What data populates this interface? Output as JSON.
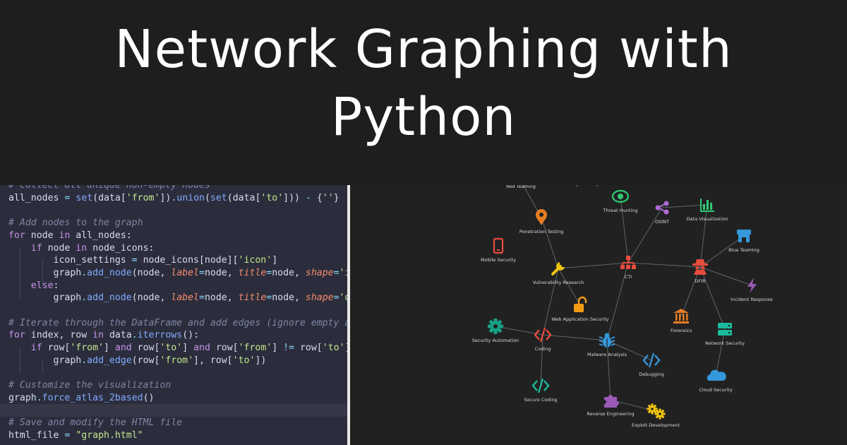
{
  "title": {
    "line1": "Network Graphing with",
    "line2": "Python"
  },
  "code": {
    "lines": [
      "# collect all unique non-empty nodes",
      "all_nodes = set(data['from']).union(set(data['to'])) - {''}",
      "",
      "# Add nodes to the graph",
      "for node in all_nodes:",
      "    if node in node_icons:",
      "        icon_settings = node_icons[node]['icon']",
      "        graph.add_node(node, label=node, title=node, shape='i",
      "    else:",
      "        graph.add_node(node, label=node, title=node, shape='d",
      "",
      "# Iterate through the DataFrame and add edges (ignore empty a",
      "for index, row in data.iterrows():",
      "    if row['from'] and row['to'] and row['from'] != row['to']",
      "        graph.add_edge(row['from'], row['to'])",
      "",
      "# Customize the visualization",
      "graph.force_atlas_2based()",
      "",
      "# Save and modify the HTML file",
      "html_file = \"graph.html\""
    ]
  },
  "graph": {
    "nodes": [
      {
        "id": "red-teaming",
        "label": "Red Teaming",
        "icon": "none-icon",
        "color": "#999999"
      },
      {
        "id": "active-directory-security",
        "label": "Active Directory Security",
        "icon": "none-icon",
        "color": "#999999"
      },
      {
        "id": "threat-hunting",
        "label": "Threat Hunting",
        "icon": "eye-icon",
        "color": "#2ecc71"
      },
      {
        "id": "osint",
        "label": "OSINT",
        "icon": "share-icon",
        "color": "#b06ad6"
      },
      {
        "id": "data-visualization",
        "label": "Data Visualization",
        "icon": "chart-icon",
        "color": "#2ecc71"
      },
      {
        "id": "penetration-testing",
        "label": "Penetration Testing",
        "icon": "map-pin-icon",
        "color": "#e67e22"
      },
      {
        "id": "blue-teaming",
        "label": "Blue Teaming",
        "icon": "store-icon",
        "color": "#3498db"
      },
      {
        "id": "mobile-security",
        "label": "Mobile Security",
        "icon": "phone-icon",
        "color": "#e74c3c"
      },
      {
        "id": "cti",
        "label": "CTI",
        "icon": "sitemap-icon",
        "color": "#e74c3c"
      },
      {
        "id": "dfir",
        "label": "DFIR",
        "icon": "detective-icon",
        "color": "#e74c3c"
      },
      {
        "id": "vulnerability-research",
        "label": "Vulnerability Research",
        "icon": "wrench-icon",
        "color": "#f1c40f"
      },
      {
        "id": "incident-response",
        "label": "Incident Response",
        "icon": "bolt-icon",
        "color": "#9b59b6"
      },
      {
        "id": "web-application-security",
        "label": "Web Application Security",
        "icon": "unlock-icon",
        "color": "#f39c12"
      },
      {
        "id": "forensics",
        "label": "Forensics",
        "icon": "bank-icon",
        "color": "#e67e22"
      },
      {
        "id": "security-automation",
        "label": "Security Automation",
        "icon": "gear-icon",
        "color": "#16a085"
      },
      {
        "id": "coding",
        "label": "Coding",
        "icon": "code-icon",
        "color": "#e74c3c"
      },
      {
        "id": "malware-analysis",
        "label": "Malware Analysis",
        "icon": "bug-icon",
        "color": "#3498db"
      },
      {
        "id": "network-security",
        "label": "Network Security",
        "icon": "server-icon",
        "color": "#1abc9c"
      },
      {
        "id": "debugging",
        "label": "Debugging",
        "icon": "code-icon",
        "color": "#3498db"
      },
      {
        "id": "cloud-security",
        "label": "Cloud Security",
        "icon": "cloud-icon",
        "color": "#3498db"
      },
      {
        "id": "secure-coding",
        "label": "Secure Coding",
        "icon": "code-icon",
        "color": "#1abc9c"
      },
      {
        "id": "reverse-engineering",
        "label": "Reverse Engineering",
        "icon": "puzzle-icon",
        "color": "#9b59b6"
      },
      {
        "id": "exploit-development",
        "label": "Exploit Development",
        "icon": "gears-icon",
        "color": "#f1c40f"
      }
    ],
    "edges": [
      [
        "red-teaming",
        "penetration-testing"
      ],
      [
        "penetration-testing",
        "vulnerability-research"
      ],
      [
        "vulnerability-research",
        "cti"
      ],
      [
        "vulnerability-research",
        "web-application-security"
      ],
      [
        "vulnerability-research",
        "coding"
      ],
      [
        "threat-hunting",
        "cti"
      ],
      [
        "osint",
        "cti"
      ],
      [
        "osint",
        "data-visualization"
      ],
      [
        "data-visualization",
        "dfir"
      ],
      [
        "cti",
        "dfir"
      ],
      [
        "cti",
        "malware-analysis"
      ],
      [
        "blue-teaming",
        "dfir"
      ],
      [
        "dfir",
        "incident-response"
      ],
      [
        "dfir",
        "forensics"
      ],
      [
        "dfir",
        "network-security"
      ],
      [
        "network-security",
        "cloud-security"
      ],
      [
        "security-automation",
        "coding"
      ],
      [
        "coding",
        "malware-analysis"
      ],
      [
        "coding",
        "secure-coding"
      ],
      [
        "malware-analysis",
        "debugging"
      ],
      [
        "malware-analysis",
        "reverse-engineering"
      ],
      [
        "reverse-engineering",
        "exploit-development"
      ]
    ]
  }
}
